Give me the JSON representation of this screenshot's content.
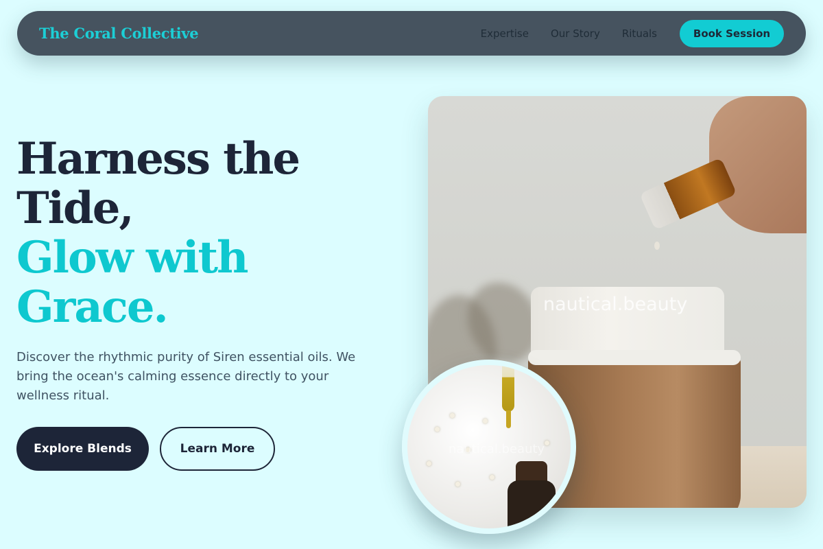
{
  "nav": {
    "brand": "The Coral Collective",
    "links": [
      "Expertise",
      "Our Story",
      "Rituals"
    ],
    "cta": "Book Session"
  },
  "hero": {
    "headline_dark": [
      "Harness the",
      "Tide,"
    ],
    "headline_teal": [
      "Glow with",
      "Grace."
    ],
    "description": "Discover the rhythmic purity of Siren essential oils. We bring the ocean's calming essence directly to your wellness ritual.",
    "primary_button": "Explore Blends",
    "secondary_button": "Learn More"
  },
  "images": {
    "main_watermark": "nautical.beauty",
    "inset_watermark": "nautical.beauty"
  },
  "colors": {
    "background": "#dcfdff",
    "nav_background": "#46535f",
    "accent": "#0ec8cf",
    "dark": "#1d2538"
  }
}
